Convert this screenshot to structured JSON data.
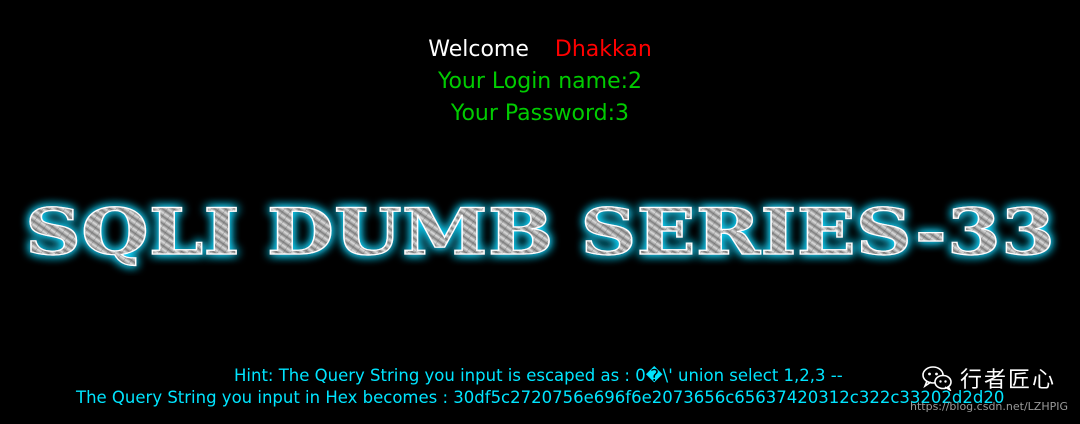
{
  "welcome": {
    "greeting": "Welcome",
    "user": "Dhakkan",
    "login_line": "Your Login name:2",
    "password_line": "Your Password:3"
  },
  "banner": {
    "title": "SQLI DUMB SERIES-33"
  },
  "hint": {
    "query_escaped": "Hint: The Query String you input is escaped as : 0�\\' union select 1,2,3 --",
    "query_hex": "The Query String you input in Hex becomes : 30df5c2720756e696f6e2073656c65637420312c322c33202d2d20"
  },
  "watermark": {
    "icon": "wechat-icon",
    "brand": "行者匠心",
    "url": "https://blog.csdn.net/LZHPIG"
  },
  "colors": {
    "background": "#000000",
    "welcome": "#ffffff",
    "user": "#ff0000",
    "credentials": "#00cc00",
    "hint": "#00e5ff",
    "banner_glow": "#19d8ff"
  }
}
